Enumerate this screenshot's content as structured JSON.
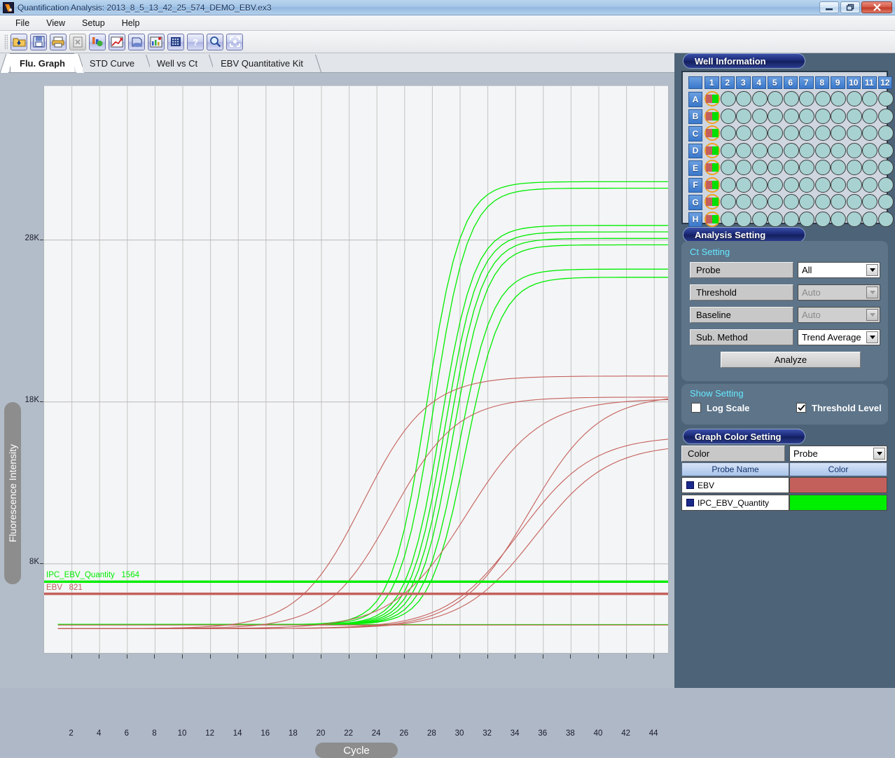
{
  "window": {
    "title": "Quantification Analysis: 2013_8_5_13_42_25_574_DEMO_EBV.ex3",
    "app_icon": "app-icon",
    "minimize": "minimize-button",
    "restore": "restore-button",
    "close": "close-button"
  },
  "menu": {
    "items": [
      {
        "label": "File"
      },
      {
        "label": "View"
      },
      {
        "label": "Setup"
      },
      {
        "label": "Help"
      }
    ]
  },
  "toolbar": {
    "buttons": [
      {
        "name": "open-file-icon",
        "disabled": false
      },
      {
        "name": "save-icon",
        "disabled": false
      },
      {
        "name": "print-icon",
        "disabled": false
      },
      {
        "name": "export-excel-icon",
        "disabled": true
      },
      {
        "name": "analysis-icon",
        "disabled": false
      },
      {
        "name": "std-curve-icon",
        "disabled": false
      },
      {
        "name": "report-icon",
        "disabled": false
      },
      {
        "name": "melt-curve-icon",
        "disabled": false
      },
      {
        "name": "plate-grid-icon",
        "disabled": false
      },
      {
        "name": "help-icon",
        "disabled": false
      },
      {
        "name": "zoom-icon",
        "disabled": false
      },
      {
        "name": "fit-screen-icon",
        "disabled": false
      }
    ]
  },
  "tabs": [
    {
      "label": "Flu. Graph",
      "active": true
    },
    {
      "label": "STD Curve",
      "active": false
    },
    {
      "label": "Well vs Ct",
      "active": false
    },
    {
      "label": "EBV Quantitative Kit",
      "active": false
    }
  ],
  "well_information": {
    "title": "Well Information",
    "columns": [
      "1",
      "2",
      "3",
      "4",
      "5",
      "6",
      "7",
      "8",
      "9",
      "10",
      "11",
      "12"
    ],
    "rows": [
      "A",
      "B",
      "C",
      "D",
      "E",
      "F",
      "G",
      "H"
    ],
    "selected_column": 1,
    "selected_left_color": "#c4605c",
    "selected_right_color": "#00e000",
    "empty_well_color": "#a8d2d2",
    "selection_ring_color": "#f0a020"
  },
  "analysis_setting": {
    "title": "Analysis Setting",
    "ct_setting_title": "Ct Setting",
    "fields": [
      {
        "label": "Probe",
        "value": "All",
        "disabled": false
      },
      {
        "label": "Threshold",
        "value": "Auto",
        "disabled": true
      },
      {
        "label": "Baseline",
        "value": "Auto",
        "disabled": true
      },
      {
        "label": "Sub. Method",
        "value": "Trend Average",
        "disabled": false
      }
    ],
    "analyze_button": "Analyze"
  },
  "show_setting": {
    "title": "Show Setting",
    "log_scale": {
      "label": "Log Scale",
      "checked": false
    },
    "threshold_level": {
      "label": "Threshold Level",
      "checked": true
    }
  },
  "graph_color_setting": {
    "title": "Graph Color Setting",
    "color_label": "Color",
    "mode_value": "Probe",
    "header_probe": "Probe Name",
    "header_color": "Color",
    "rows": [
      {
        "probe": "EBV",
        "color": "#c4605c"
      },
      {
        "probe": "IPC_EBV_Quantity",
        "color": "#00ee00"
      }
    ]
  },
  "chart_data": {
    "type": "line",
    "title": "",
    "xlabel": "Cycle",
    "ylabel": "Fluorescence Intensity",
    "xlim": [
      0,
      45
    ],
    "ylim": [
      2500,
      37500
    ],
    "xticks": [
      2,
      4,
      6,
      8,
      10,
      12,
      14,
      16,
      18,
      20,
      22,
      24,
      26,
      28,
      30,
      32,
      34,
      36,
      38,
      40,
      42,
      44
    ],
    "yticks": [
      8000,
      18000,
      28000
    ],
    "ytick_labels": [
      "8K",
      "18K",
      "28K"
    ],
    "grid": true,
    "legend": "none",
    "thresholds": [
      {
        "name": "IPC_EBV_Quantity",
        "value": 1564,
        "display_y": 6900,
        "color": "#00ee00"
      },
      {
        "name": "EBV",
        "value": 821,
        "display_y": 6150,
        "color": "#c4605c"
      }
    ],
    "series": [
      {
        "name": "IPC_EBV_Quantity A1",
        "color": "#00ee00",
        "baseline": 4250,
        "plateau": 31600,
        "ct": 27.6,
        "slope": 0.8
      },
      {
        "name": "IPC_EBV_Quantity B1",
        "color": "#00ee00",
        "baseline": 4250,
        "plateau": 31200,
        "ct": 28.1,
        "slope": 0.8
      },
      {
        "name": "IPC_EBV_Quantity C1",
        "color": "#00ee00",
        "baseline": 4250,
        "plateau": 28900,
        "ct": 28.6,
        "slope": 0.82
      },
      {
        "name": "IPC_EBV_Quantity D1",
        "color": "#00ee00",
        "baseline": 4250,
        "plateau": 28500,
        "ct": 28.9,
        "slope": 0.82
      },
      {
        "name": "IPC_EBV_Quantity E1",
        "color": "#00ee00",
        "baseline": 4250,
        "plateau": 28100,
        "ct": 29.2,
        "slope": 0.82
      },
      {
        "name": "IPC_EBV_Quantity F1",
        "color": "#00ee00",
        "baseline": 4250,
        "plateau": 27700,
        "ct": 29.5,
        "slope": 0.82
      },
      {
        "name": "IPC_EBV_Quantity G1",
        "color": "#00ee00",
        "baseline": 4250,
        "plateau": 26200,
        "ct": 29.9,
        "slope": 0.8
      },
      {
        "name": "IPC_EBV_Quantity H1",
        "color": "#00ee00",
        "baseline": 4250,
        "plateau": 25700,
        "ct": 30.4,
        "slope": 0.78
      },
      {
        "name": "IPC_EBV_Quantity flat",
        "color": "#00ee00",
        "baseline": 4250,
        "plateau": 4250,
        "ct": 99,
        "slope": 0.5
      },
      {
        "name": "EBV A1",
        "color": "#c4605c",
        "baseline": 4000,
        "plateau": 19600,
        "ct": 23.0,
        "slope": 0.43
      },
      {
        "name": "EBV B1",
        "color": "#c4605c",
        "baseline": 4000,
        "plateau": 18300,
        "ct": 25.1,
        "slope": 0.43
      },
      {
        "name": "EBV C1",
        "color": "#c4605c",
        "baseline": 4000,
        "plateau": 18200,
        "ct": 30.5,
        "slope": 0.38
      },
      {
        "name": "EBV D1",
        "color": "#c4605c",
        "baseline": 4000,
        "plateau": 18450,
        "ct": 35.0,
        "slope": 0.4
      },
      {
        "name": "EBV E1",
        "color": "#c4605c",
        "baseline": 4000,
        "plateau": 15900,
        "ct": 34.3,
        "slope": 0.38
      },
      {
        "name": "EBV F1",
        "color": "#c4605c",
        "baseline": 4000,
        "plateau": 15400,
        "ct": 35.4,
        "slope": 0.38
      },
      {
        "name": "EBV flat",
        "color": "#c4605c",
        "baseline": 4220,
        "plateau": 4220,
        "ct": 99,
        "slope": 0.5
      }
    ]
  }
}
